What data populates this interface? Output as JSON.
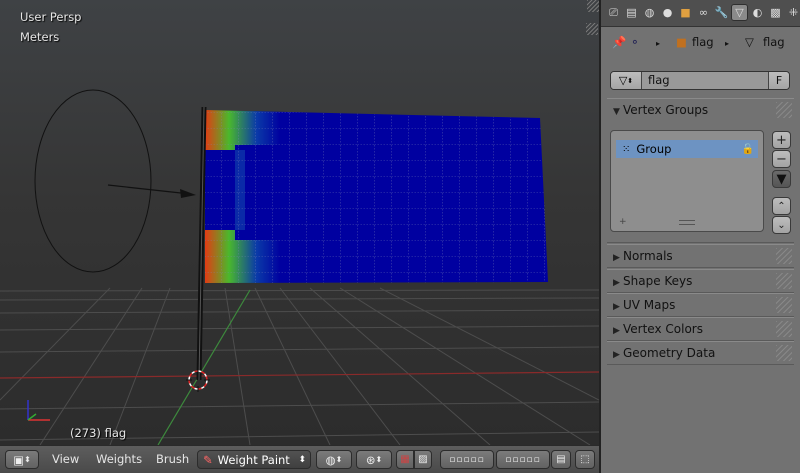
{
  "viewport": {
    "view_name": "User Persp",
    "units": "Meters",
    "object_info": "(273) flag"
  },
  "header": {
    "menus": [
      "View",
      "Weights",
      "Brush"
    ],
    "mode": "Weight Paint"
  },
  "properties": {
    "tab_icons": [
      "render-icon",
      "render-layers-icon",
      "scene-icon",
      "world-icon",
      "object-icon",
      "constraints-icon",
      "modifiers-icon",
      "mesh-data-icon",
      "material-icon",
      "texture-icon",
      "particles-icon"
    ],
    "active_tab": "mesh-data-icon",
    "breadcrumb": {
      "object": "flag",
      "mesh": "flag"
    },
    "datablock_name": "flag",
    "fake_user_label": "F",
    "panels": {
      "vertex_groups": "Vertex Groups",
      "normals": "Normals",
      "shape_keys": "Shape Keys",
      "uv_maps": "UV Maps",
      "vertex_colors": "Vertex Colors",
      "geometry_data": "Geometry Data"
    },
    "vertex_groups": [
      "Group"
    ]
  },
  "colors": {
    "weight_low": "#0000a0",
    "weight_high": "#ff2000",
    "selection_blue": "#6d93c2",
    "panel_bg": "#727272"
  }
}
